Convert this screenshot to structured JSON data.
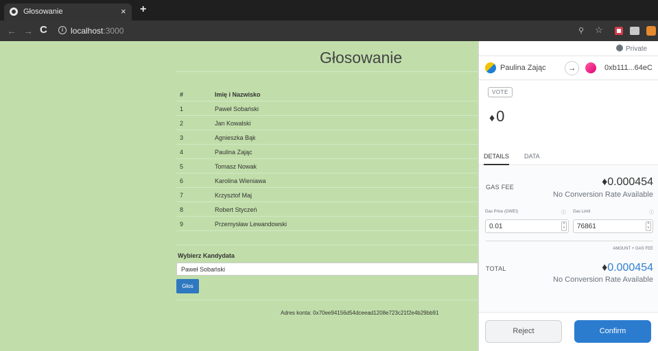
{
  "browser": {
    "tab_title": "Głosowanie",
    "tab_close": "×",
    "new_tab": "+",
    "url_host": "localhost",
    "url_port": ":3000"
  },
  "page": {
    "title": "Głosowanie",
    "table": {
      "headers": [
        "#",
        "Imię i Nazwisko"
      ],
      "rows": [
        {
          "num": "1",
          "name": "Paweł Sobański"
        },
        {
          "num": "2",
          "name": "Jan Kowalski"
        },
        {
          "num": "3",
          "name": "Agnieszka Bąk"
        },
        {
          "num": "4",
          "name": "Paulina Zając"
        },
        {
          "num": "5",
          "name": "Tomasz Nowak"
        },
        {
          "num": "6",
          "name": "Karolina Wieniawa"
        },
        {
          "num": "7",
          "name": "Krzysztof Maj"
        },
        {
          "num": "8",
          "name": "Robert Styczeń"
        },
        {
          "num": "9",
          "name": "Przemysław Lewandowski"
        }
      ]
    },
    "vote_label": "Wybierz Kandydata",
    "selected_candidate": "Paweł Sobański",
    "vote_button": "Głos",
    "account_text": "Adres konta: 0x70ee94156d54dceead1208e723c21f2e4b29bb91"
  },
  "metamask": {
    "private_label": "Private",
    "from_name": "Paulina Zając",
    "arrow": "→",
    "to_address": "0xb111...64eC",
    "method": "VOTE",
    "amount": "0",
    "eth_symbol": "♦",
    "tabs": {
      "details": "DETAILS",
      "data": "DATA"
    },
    "gas_fee_label": "GAS FEE",
    "gas_fee": "0.000454",
    "no_conversion": "No Conversion Rate Available",
    "gas_price_label": "Gas Price (GWEI)",
    "gas_price": "0.01",
    "gas_limit_label": "Gas Limit",
    "gas_limit": "76861",
    "amount_gas_label": "AMOUNT + GAS FEE",
    "total_label": "TOTAL",
    "total": "0.000454",
    "reject": "Reject",
    "confirm": "Confirm",
    "colors": {
      "confirm": "#2b7ccf",
      "total": "#2f80d1"
    }
  }
}
